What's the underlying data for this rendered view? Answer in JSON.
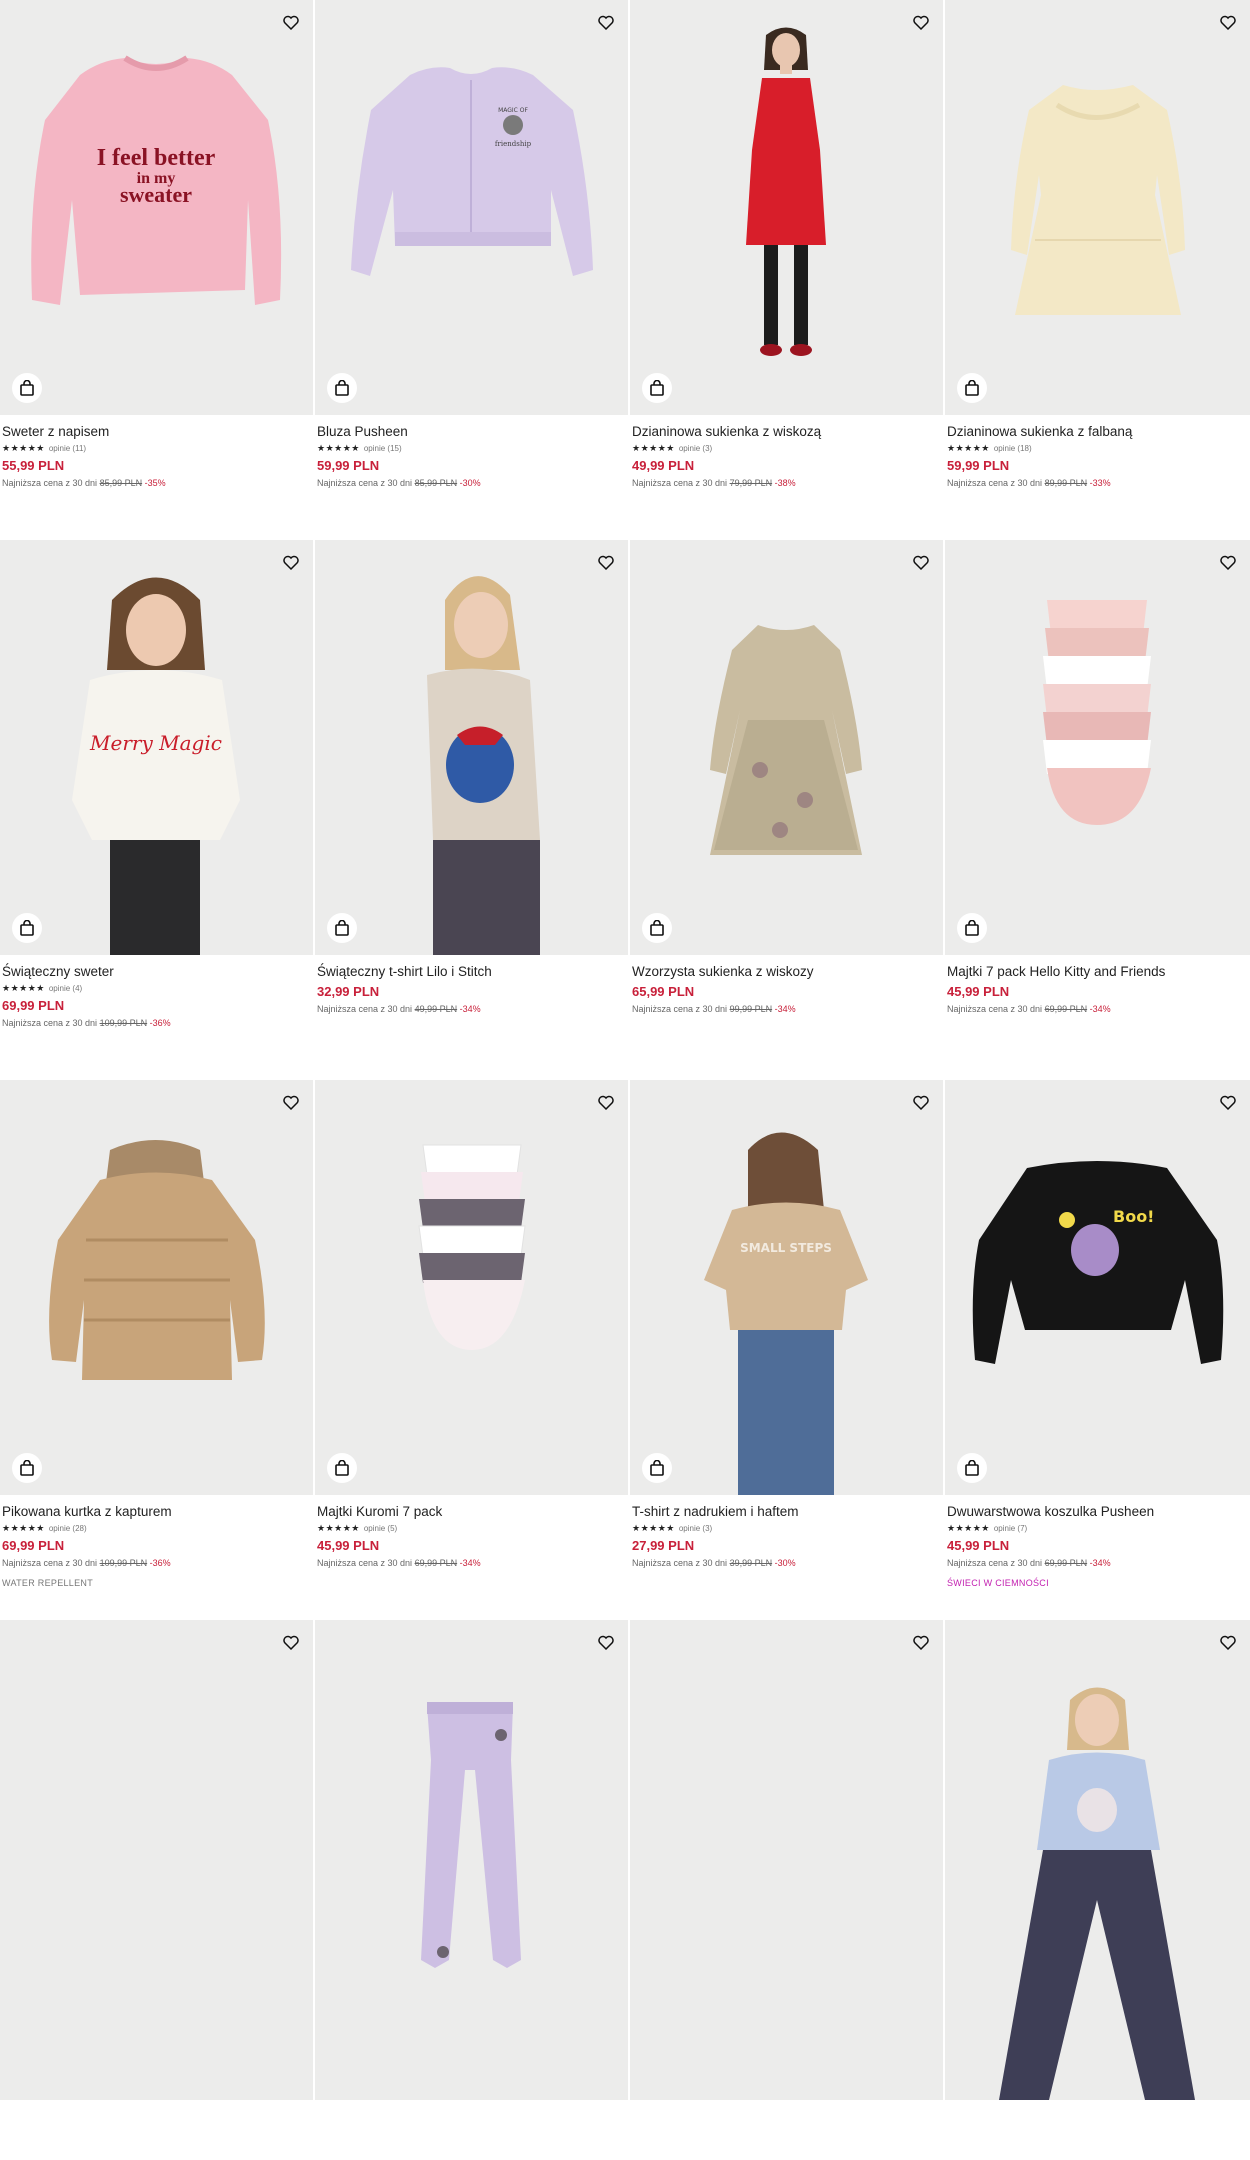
{
  "colors": {
    "price": "#c8203a",
    "tag_grey": "#777777",
    "tag_glow": "#c21fb0"
  },
  "icons": {
    "favorite": "heart-icon",
    "cart": "shopping-bag-icon",
    "star": "star-icon"
  },
  "products": [
    {
      "title": "Sweter z napisem",
      "stars": "★★★★★",
      "reviews": "opinie (11)",
      "price": "55,99 PLN",
      "lowest_label": "Najniższa cena z 30 dni",
      "old_price": "85,99 PLN",
      "discount": "-35%",
      "tag": ""
    },
    {
      "title": "Bluza Pusheen",
      "stars": "★★★★★",
      "reviews": "opinie (15)",
      "price": "59,99 PLN",
      "lowest_label": "Najniższa cena z 30 dni",
      "old_price": "85,99 PLN",
      "discount": "-30%",
      "tag": ""
    },
    {
      "title": "Dzianinowa sukienka z wiskozą",
      "stars": "★★★★★",
      "reviews": "opinie (3)",
      "price": "49,99 PLN",
      "lowest_label": "Najniższa cena z 30 dni",
      "old_price": "79,99 PLN",
      "discount": "-38%",
      "tag": ""
    },
    {
      "title": "Dzianinowa sukienka z falbaną",
      "stars": "★★★★★",
      "reviews": "opinie (18)",
      "price": "59,99 PLN",
      "lowest_label": "Najniższa cena z 30 dni",
      "old_price": "89,99 PLN",
      "discount": "-33%",
      "tag": ""
    },
    {
      "title": "Świąteczny sweter",
      "stars": "★★★★★",
      "reviews": "opinie (4)",
      "price": "69,99 PLN",
      "lowest_label": "Najniższa cena z 30 dni",
      "old_price": "109,99 PLN",
      "discount": "-36%",
      "tag": ""
    },
    {
      "title": "Świąteczny t-shirt Lilo i Stitch",
      "stars": "",
      "reviews": "",
      "price": "32,99 PLN",
      "lowest_label": "Najniższa cena z 30 dni",
      "old_price": "49,99 PLN",
      "discount": "-34%",
      "tag": ""
    },
    {
      "title": "Wzorzysta sukienka z wiskozy",
      "stars": "",
      "reviews": "",
      "price": "65,99 PLN",
      "lowest_label": "Najniższa cena z 30 dni",
      "old_price": "99,99 PLN",
      "discount": "-34%",
      "tag": ""
    },
    {
      "title": "Majtki 7 pack Hello Kitty and Friends",
      "stars": "",
      "reviews": "",
      "price": "45,99 PLN",
      "lowest_label": "Najniższa cena z 30 dni",
      "old_price": "69,99 PLN",
      "discount": "-34%",
      "tag": ""
    },
    {
      "title": "Pikowana kurtka z kapturem",
      "stars": "★★★★★",
      "reviews": "opinie (28)",
      "price": "69,99 PLN",
      "lowest_label": "Najniższa cena z 30 dni",
      "old_price": "109,99 PLN",
      "discount": "-36%",
      "tag": "WATER REPELLENT"
    },
    {
      "title": "Majtki Kuromi 7 pack",
      "stars": "★★★★★",
      "reviews": "opinie (5)",
      "price": "45,99 PLN",
      "lowest_label": "Najniższa cena z 30 dni",
      "old_price": "69,99 PLN",
      "discount": "-34%",
      "tag": ""
    },
    {
      "title": "T-shirt z nadrukiem i haftem",
      "stars": "★★★★★",
      "reviews": "opinie (3)",
      "price": "27,99 PLN",
      "lowest_label": "Najniższa cena z 30 dni",
      "old_price": "39,99 PLN",
      "discount": "-30%",
      "tag": ""
    },
    {
      "title": "Dwuwarstwowa koszulka Pusheen",
      "stars": "★★★★★",
      "reviews": "opinie (7)",
      "price": "45,99 PLN",
      "lowest_label": "Najniższa cena z 30 dni",
      "old_price": "69,99 PLN",
      "discount": "-34%",
      "tag": "ŚWIECI W CIEMNOŚCI"
    },
    {
      "title": "",
      "stars": "",
      "reviews": "",
      "price": "",
      "lowest_label": "",
      "old_price": "",
      "discount": "",
      "tag": ""
    },
    {
      "title": "",
      "stars": "",
      "reviews": "",
      "price": "",
      "lowest_label": "",
      "old_price": "",
      "discount": "",
      "tag": ""
    },
    {
      "title": "",
      "stars": "",
      "reviews": "",
      "price": "",
      "lowest_label": "",
      "old_price": "",
      "discount": "",
      "tag": ""
    },
    {
      "title": "",
      "stars": "",
      "reviews": "",
      "price": "",
      "lowest_label": "",
      "old_price": "",
      "discount": "",
      "tag": ""
    }
  ]
}
